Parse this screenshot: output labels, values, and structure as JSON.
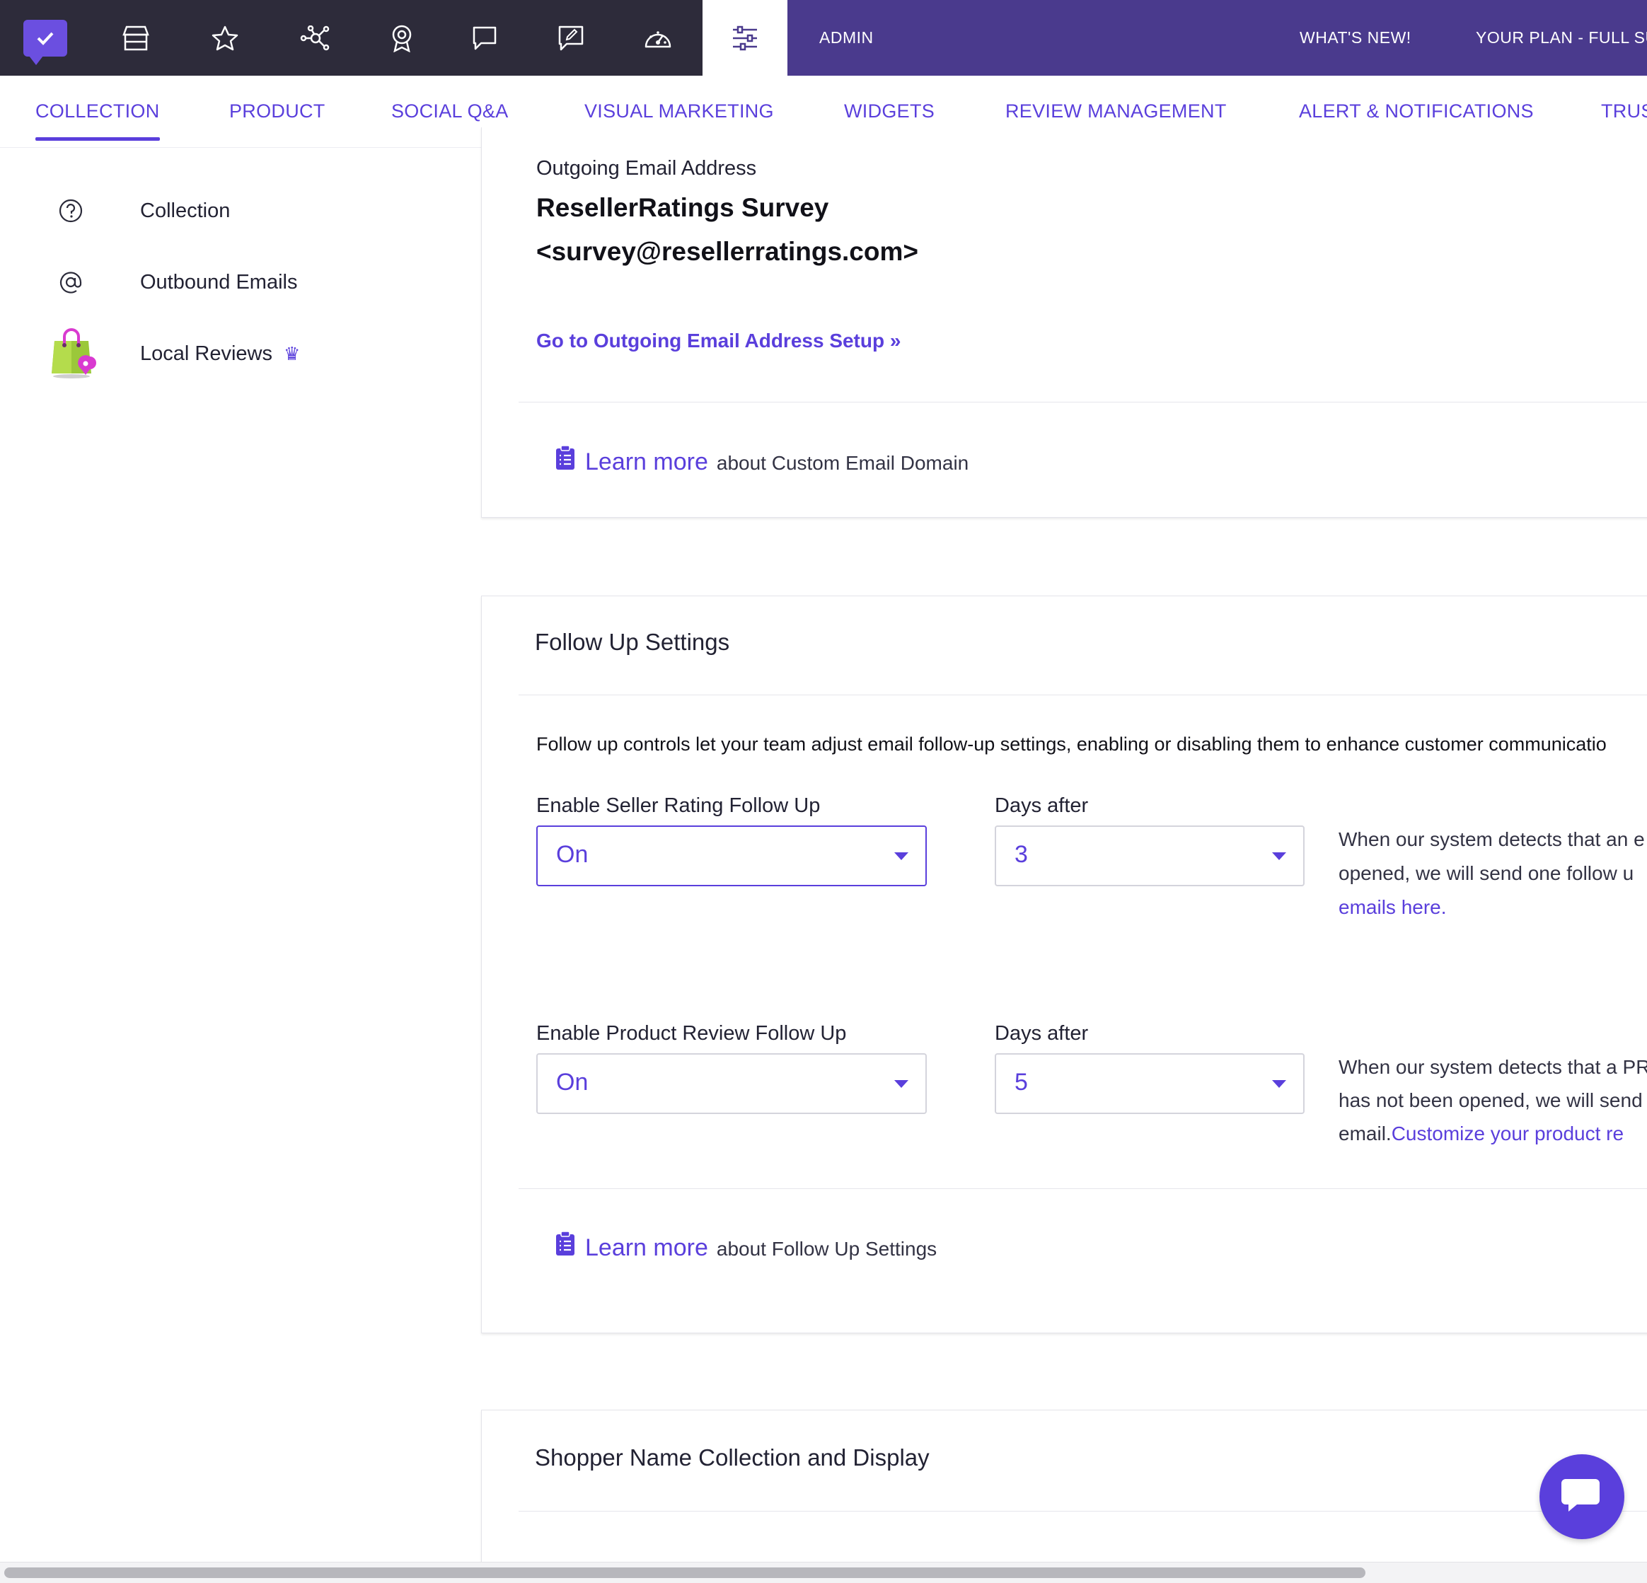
{
  "topbar": {
    "icons": [
      "logo-check-icon",
      "store-icon",
      "star-icon",
      "network-icon",
      "award-icon",
      "chat-icon",
      "edit-bubble-icon",
      "dashboard-icon",
      "sliders-icon"
    ],
    "admin_label": "ADMIN",
    "whats_new_label": "WHAT'S NEW!",
    "plan_label": "YOUR PLAN - FULL SU",
    "colors": {
      "dark": "#2d2b3a",
      "purple": "#4a3a8d",
      "accent": "#5a3fdc"
    }
  },
  "tabs": [
    {
      "label": "COLLECTION",
      "active": true
    },
    {
      "label": "PRODUCT"
    },
    {
      "label": "SOCIAL Q&A"
    },
    {
      "label": "VISUAL MARKETING"
    },
    {
      "label": "WIDGETS"
    },
    {
      "label": "REVIEW MANAGEMENT"
    },
    {
      "label": "ALERT & NOTIFICATIONS"
    },
    {
      "label": "TRUS"
    }
  ],
  "sidebar": {
    "items": [
      {
        "label": "Collection",
        "icon": "question-circle-icon"
      },
      {
        "label": "Outbound Emails",
        "icon": "at-sign-icon"
      },
      {
        "label": "Local Reviews",
        "icon": "shopping-bag-location-icon",
        "badge": "crown-icon"
      }
    ]
  },
  "outgoing": {
    "label": "Outgoing Email Address",
    "name_line": "ResellerRatings Survey",
    "email_line": "<survey@resellerratings.com>",
    "setup_link": "Go to Outgoing Email Address Setup »",
    "learn_more": "Learn more",
    "learn_more_rest": "about Custom Email Domain"
  },
  "followup": {
    "title": "Follow Up Settings",
    "description": "Follow up controls let your team adjust email follow-up settings, enabling or disabling them to enhance customer communicatio",
    "seller": {
      "label": "Enable Seller Rating Follow Up",
      "value": "On",
      "days_label": "Days after",
      "days_value": "3",
      "help_line1": "When our system detects that an e",
      "help_line2": "opened, we will send one follow u",
      "help_link": "emails here."
    },
    "product": {
      "label": "Enable Product Review Follow Up",
      "value": "On",
      "days_label": "Days after",
      "days_value": "5",
      "help_line1": "When our system detects that a PR",
      "help_line2": "has not been opened, we will send",
      "help_line3_prefix": "email.",
      "help_link": "Customize your product re"
    },
    "learn_more": "Learn more",
    "learn_more_rest": "about Follow Up Settings"
  },
  "shopper": {
    "title": "Shopper Name Collection and Display"
  },
  "chat_widget": {
    "icon": "chat-bubble-icon"
  }
}
